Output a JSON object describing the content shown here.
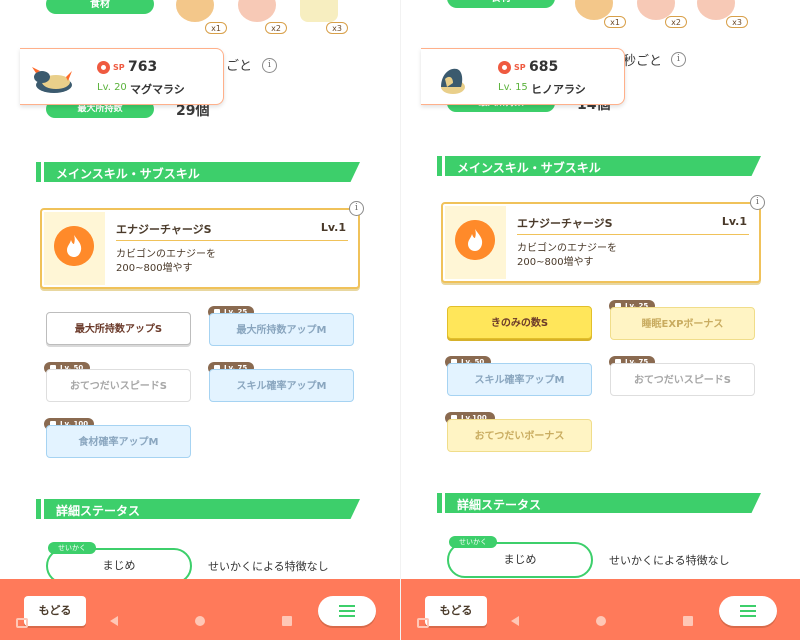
{
  "panels": [
    {
      "top_pill": "食材",
      "ingredients": [
        {
          "icon": "fried-chicken-icon",
          "count": "x1"
        },
        {
          "icon": "meat-icon",
          "count": "x2"
        },
        {
          "icon": "milk-jar-icon",
          "count": "x3"
        }
      ],
      "per_second_partial": "ごと",
      "max_label": "最大所持数",
      "max_value": "29個",
      "pokemon": {
        "sp_label": "SP",
        "sp_value": "763",
        "level": "Lv. 20",
        "name": "マグマラシ",
        "sprite": "quilava-sprite"
      },
      "section_skills": "メインスキル・サブスキル",
      "main_skill": {
        "name": "エナジーチャージS",
        "level": "Lv.1",
        "desc1": "カビゴンのエナジーを",
        "desc2": "200~800増やす"
      },
      "sub_skills": [
        {
          "label": "最大所持数アップS",
          "tag": ""
        },
        {
          "label": "最大所持数アップM",
          "tag": "Lv. 25"
        },
        {
          "label": "おてつだいスピードS",
          "tag": "Lv. 50"
        },
        {
          "label": "スキル確率アップM",
          "tag": "Lv. 75"
        },
        {
          "label": "食材確率アップM",
          "tag": "Lv. 100"
        }
      ],
      "section_status": "詳細ステータス",
      "nature_tag": "せいかく",
      "nature": "まじめ",
      "nature_desc": "せいかくによる特徴なし"
    },
    {
      "top_pill": "食材",
      "ingredients": [
        {
          "icon": "fried-chicken-icon",
          "count": "x1"
        },
        {
          "icon": "meat-icon",
          "count": "x2"
        },
        {
          "icon": "meat-icon",
          "count": "x3"
        }
      ],
      "per_second_partial": "秒ごと",
      "max_label": "最大所持数",
      "max_value": "14個",
      "pokemon": {
        "sp_label": "SP",
        "sp_value": "685",
        "level": "Lv. 15",
        "name": "ヒノアラシ",
        "sprite": "cyndaquil-sprite"
      },
      "section_skills": "メインスキル・サブスキル",
      "main_skill": {
        "name": "エナジーチャージS",
        "level": "Lv.1",
        "desc1": "カビゴンのエナジーを",
        "desc2": "200~800増やす"
      },
      "sub_skills": [
        {
          "label": "きのみの数S",
          "tag": ""
        },
        {
          "label": "睡眠EXPボーナス",
          "tag": "Lv. 25"
        },
        {
          "label": "スキル確率アップM",
          "tag": "Lv. 50"
        },
        {
          "label": "おてつだいスピードS",
          "tag": "Lv. 75"
        },
        {
          "label": "おてつだいボーナス",
          "tag": "Lv.100"
        }
      ],
      "section_status": "詳細ステータス",
      "nature_tag": "せいかく",
      "nature": "まじめ",
      "nature_desc": "せいかくによる特徴なし"
    }
  ],
  "bottom": {
    "back_label": "もどる",
    "menu_icon": "hamburger-menu-icon"
  },
  "colors": {
    "green": "#3dcf6b",
    "orange": "#ff7a5a",
    "gold": "#f0c25a",
    "yellow": "#ffe65a",
    "blue": "#e3f3ff"
  }
}
